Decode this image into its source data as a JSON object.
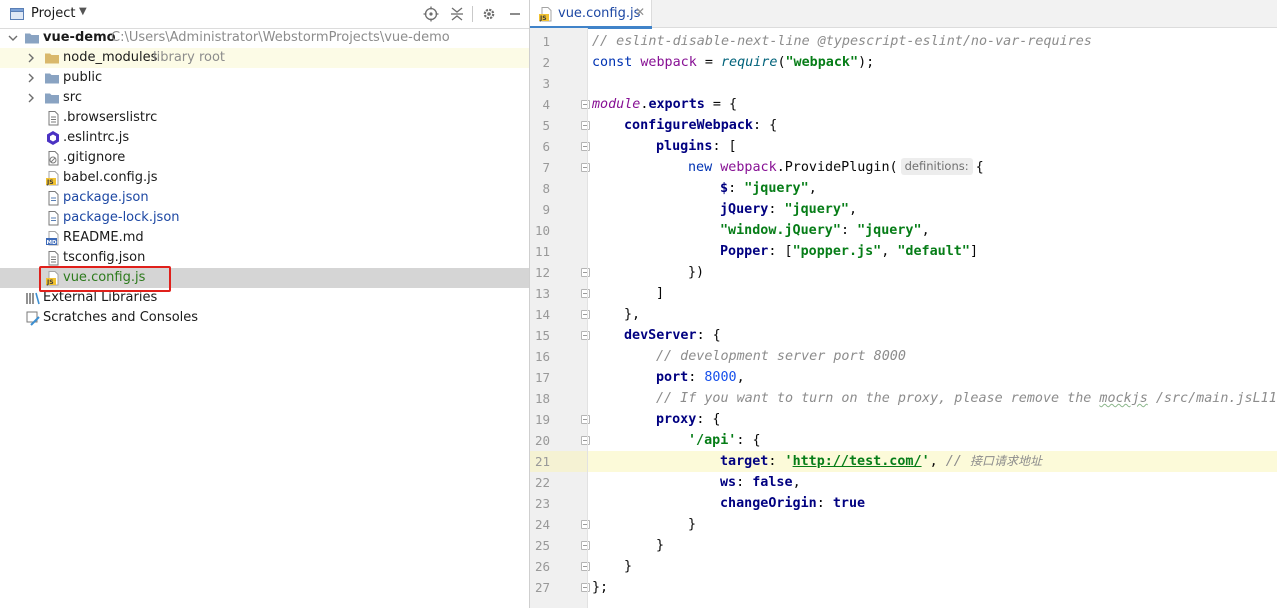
{
  "project_panel": {
    "title": "Project",
    "root": {
      "name": "vue-demo",
      "path": "C:\\Users\\Administrator\\WebstormProjects\\vue-demo"
    },
    "items": [
      {
        "label": "node_modules",
        "hint": "library root",
        "kind": "folder"
      },
      {
        "label": "public",
        "kind": "folder"
      },
      {
        "label": "src",
        "kind": "folder"
      },
      {
        "label": ".browserslistrc",
        "kind": "file"
      },
      {
        "label": ".eslintrc.js",
        "kind": "eslint"
      },
      {
        "label": ".gitignore",
        "kind": "ignore"
      },
      {
        "label": "babel.config.js",
        "kind": "js"
      },
      {
        "label": "package.json",
        "kind": "json"
      },
      {
        "label": "package-lock.json",
        "kind": "json"
      },
      {
        "label": "README.md",
        "kind": "md"
      },
      {
        "label": "tsconfig.json",
        "kind": "file"
      },
      {
        "label": "vue.config.js",
        "kind": "js"
      }
    ],
    "external_libraries": "External Libraries",
    "scratches": "Scratches and Consoles"
  },
  "editor": {
    "tab_label": "vue.config.js",
    "current_line": 21,
    "line_numbers": [
      "1",
      "2",
      "3",
      "4",
      "5",
      "6",
      "7",
      "8",
      "9",
      "10",
      "11",
      "12",
      "13",
      "14",
      "15",
      "16",
      "17",
      "18",
      "19",
      "20",
      "21",
      "22",
      "23",
      "24",
      "25",
      "26",
      "27"
    ],
    "inlay_hint": "definitions:",
    "lines": {
      "l1": "// eslint-disable-next-line @typescript-eslint/no-var-requires",
      "l2_const": "const",
      "l2_var": "webpack",
      "l2_eq": " = ",
      "l2_req": "require",
      "l2_open": "(",
      "l2_str": "\"webpack\"",
      "l2_close": ");",
      "l4_mod": "module",
      "l4_dot": ".",
      "l4_exp": "exports",
      "l4_rest": " = {",
      "l5_key": "configureWebpack",
      "l5_rest": ": {",
      "l6_key": "plugins",
      "l6_rest": ": [",
      "l7_new": "new",
      "l7_var": "webpack",
      "l7_rest": ".ProvidePlugin(",
      "l7_end": "{",
      "l8_key": "$",
      "l8_sep": ": ",
      "l8_val": "\"jquery\"",
      "l8_end": ",",
      "l9_key": "jQuery",
      "l9_sep": ": ",
      "l9_val": "\"jquery\"",
      "l9_end": ",",
      "l10_key": "\"window.jQuery\"",
      "l10_sep": ": ",
      "l10_val": "\"jquery\"",
      "l10_end": ",",
      "l11_key": "Popper",
      "l11_sep": ": [",
      "l11_v1": "\"popper.js\"",
      "l11_comma": ", ",
      "l11_v2": "\"default\"",
      "l11_end": "]",
      "l12": "})",
      "l13": "]",
      "l14": "},",
      "l15_key": "devServer",
      "l15_rest": ": {",
      "l16": "// development server port 8000",
      "l17_key": "port",
      "l17_sep": ": ",
      "l17_val": "8000",
      "l17_end": ",",
      "l18_a": "// If you want to turn on the proxy, please remove the ",
      "l18_b": "mockjs",
      "l18_c": " /src/main.jsL11",
      "l19_key": "proxy",
      "l19_rest": ": {",
      "l20_key": "'/api'",
      "l20_rest": ": {",
      "l21_key": "target",
      "l21_sep": ": ",
      "l21_q1": "'",
      "l21_url": "http://test.com/",
      "l21_q2": "'",
      "l21_comma": ", ",
      "l21_cm": "// ",
      "l21_cn": "接口请求地址",
      "l22_key": "ws",
      "l22_sep": ": ",
      "l22_val": "false",
      "l22_end": ",",
      "l23_key": "changeOrigin",
      "l23_sep": ": ",
      "l23_val": "true",
      "l24": "}",
      "l25": "}",
      "l26": "}",
      "l27": "};"
    }
  },
  "colors": {
    "selection_row": "#d5d5d5",
    "library_root_row": "#fcfbe6",
    "highlight_box": "#e0201b",
    "tab_underline": "#4083c9",
    "current_line": "#fcfad9"
  }
}
